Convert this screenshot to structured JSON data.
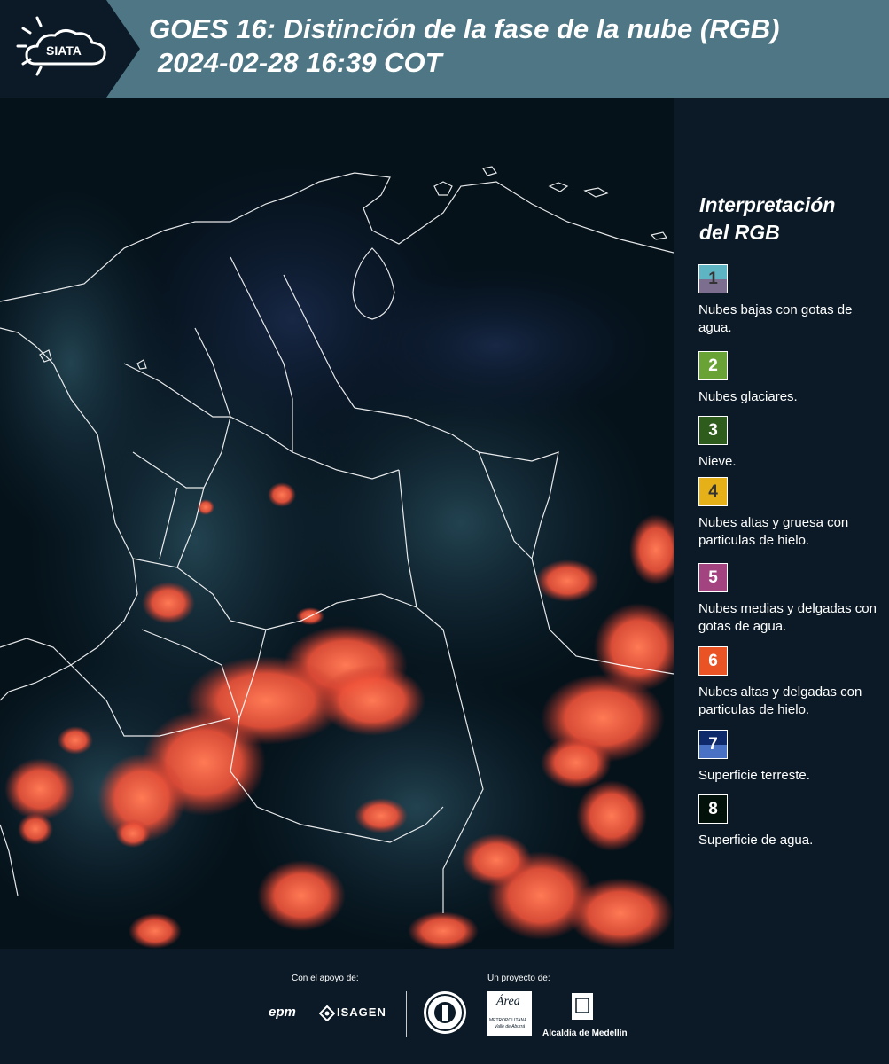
{
  "header": {
    "logo_text": "SIATA",
    "title_line1": "GOES 16: Distinción de la fase de la nube (RGB)",
    "title_line2": "2024-02-28 16:39 COT",
    "bg_color": "#4e7684"
  },
  "legend": {
    "title_line1": "Interpretación",
    "title_line2": "del RGB",
    "items": [
      {
        "num": "1",
        "desc": "Nubes bajas con gotas de agua.",
        "color_top": "#5fb4c4",
        "color_bottom": "#7b6e8e",
        "num_color": "#333333"
      },
      {
        "num": "2",
        "desc": "Nubes glaciares.",
        "color_top": "#6aa335",
        "color_bottom": "#6aa335",
        "num_color": "#ffffff"
      },
      {
        "num": "3",
        "desc": "Nieve.",
        "color_top": "#2e5c1c",
        "color_bottom": "#2e5c1c",
        "num_color": "#ffffff"
      },
      {
        "num": "4",
        "desc": "Nubes altas y gruesa con particulas de hielo.",
        "color_top": "#e6b018",
        "color_bottom": "#e6b018",
        "num_color": "#333333"
      },
      {
        "num": "5",
        "desc": "Nubes medias y delgadas con gotas de agua.",
        "color_top": "#a3437f",
        "color_bottom": "#a3437f",
        "num_color": "#ffffff"
      },
      {
        "num": "6",
        "desc": "Nubes altas y delgadas con particulas de hielo.",
        "color_top": "#ea5424",
        "color_bottom": "#ea5424",
        "num_color": "#ffffff"
      },
      {
        "num": "7",
        "desc": "Superficie terreste.",
        "color_top": "#0f2a6a",
        "color_bottom": "#4a72c4",
        "num_color": "#ffffff"
      },
      {
        "num": "8",
        "desc": "Superficie de agua.",
        "color_top": "#03110b",
        "color_bottom": "#03110b",
        "num_color": "#ffffff"
      }
    ]
  },
  "footer": {
    "support_label": "Con el apoyo de:",
    "project_label": "Un proyecto de:",
    "epm": "epm",
    "isagen": "ISAGEN",
    "area": "Área",
    "area_sub": "METROPOLITANA",
    "area_sub2": "Valle de Aburrá",
    "alcaldia": "Alcaldía de Medellín"
  }
}
